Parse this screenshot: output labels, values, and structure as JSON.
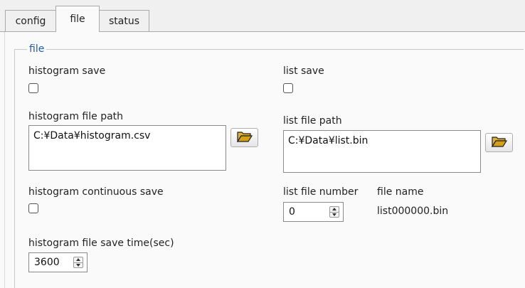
{
  "tabs": [
    {
      "label": "config"
    },
    {
      "label": "file"
    },
    {
      "label": "status"
    }
  ],
  "active_tab": "file",
  "group": {
    "title": "file"
  },
  "histogram": {
    "save_label": "histogram save",
    "save_checked": false,
    "file_path_label": "histogram file path",
    "file_path_value": "C:¥Data¥histogram.csv",
    "continuous_save_label": "histogram continuous save",
    "continuous_save_checked": false,
    "save_time_label": "histogram file save time(sec)",
    "save_time_value": "3600"
  },
  "list": {
    "save_label": "list save",
    "save_checked": false,
    "file_path_label": "list file path",
    "file_path_value": "C:¥Data¥list.bin",
    "file_number_label": "list file number",
    "file_number_value": "0",
    "file_name_label": "file name",
    "file_name_value": "list000000.bin"
  },
  "icons": {
    "browse": "folder-open-icon",
    "spin_up": "triangle-up-icon",
    "spin_down": "triangle-down-icon"
  },
  "colors": {
    "group_title": "#1a5fb4",
    "folder_icon": "#d4a017"
  }
}
